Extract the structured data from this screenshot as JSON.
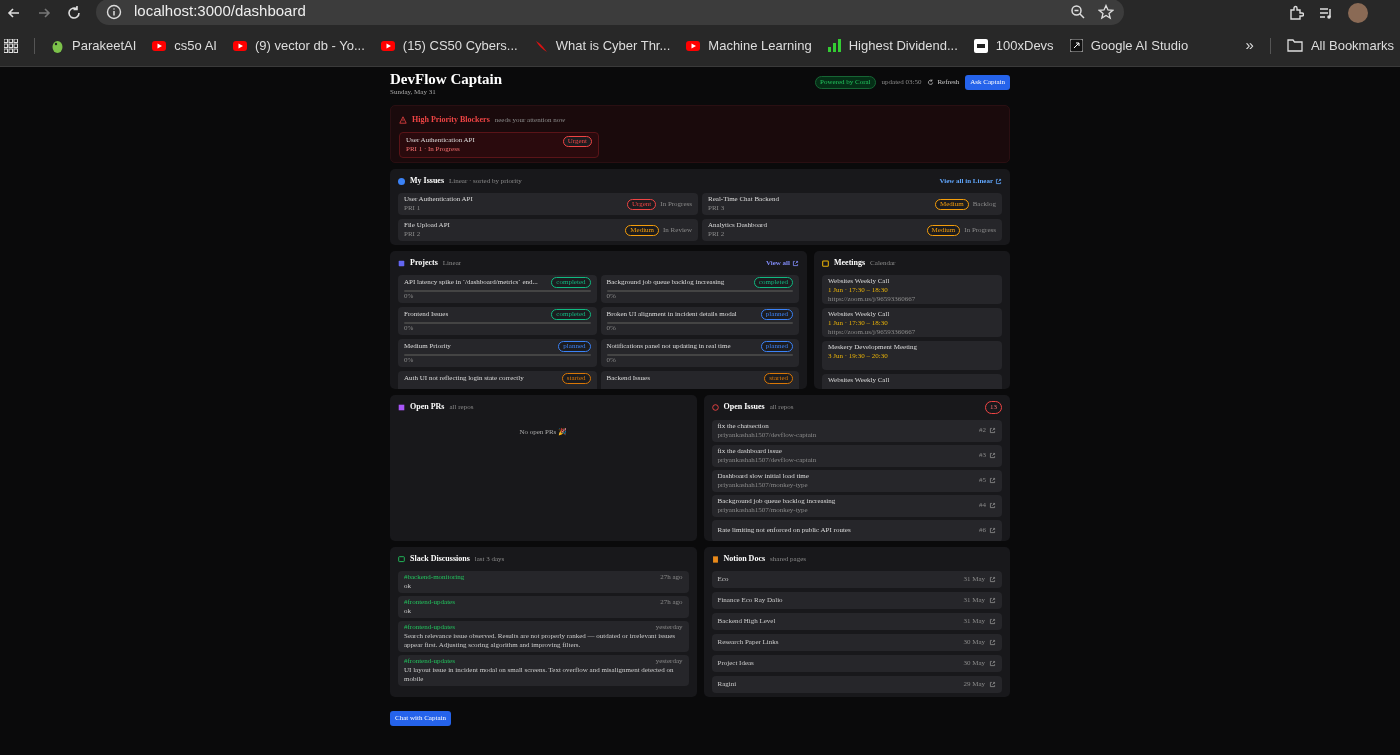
{
  "browser": {
    "url": "localhost:3000/dashboard",
    "bookmarks": [
      {
        "label": "ParakeetAI",
        "kind": "parakeet"
      },
      {
        "label": "cs5o AI",
        "kind": "video"
      },
      {
        "label": "(9) vector db - Yo...",
        "kind": "video"
      },
      {
        "label": "(15) CS50 Cybers...",
        "kind": "video"
      },
      {
        "label": "What is Cyber Thr...",
        "kind": "slash"
      },
      {
        "label": "Machine Learning",
        "kind": "video"
      },
      {
        "label": "Highest Dividend...",
        "kind": "bars"
      },
      {
        "label": "100xDevs",
        "kind": "tile"
      },
      {
        "label": "Google AI Studio",
        "kind": "studio"
      }
    ],
    "overflow": "»",
    "all_bookmarks": "All Bookmarks"
  },
  "header": {
    "title": "DevFlow Captain",
    "date": "Sunday, May 31",
    "powered": "Powered by Coral",
    "updated": "updated 03:50",
    "refresh": "Refresh",
    "ask": "Ask Captain"
  },
  "blockers": {
    "title": "High Priority Blockers",
    "subtitle": "needs your attention now",
    "items": [
      {
        "title": "User Authentication API",
        "meta": "PRI 1 · In Progress",
        "badge": {
          "label": "Urgent",
          "color": "#ef4444"
        }
      }
    ]
  },
  "my_issues": {
    "title": "My Issues",
    "subtitle": "Linear · sorted by priority",
    "link": "View all in Linear",
    "items": [
      {
        "title": "User Authentication API",
        "meta": "PRI 1",
        "badge": {
          "label": "Urgent",
          "color": "#ef4444"
        },
        "status": "In Progress"
      },
      {
        "title": "Real-Time Chat Backend",
        "meta": "PRI 3",
        "badge": {
          "label": "Medium",
          "color": "#f59e0b"
        },
        "status": "Backlog"
      },
      {
        "title": "File Upload API",
        "meta": "PRI 2",
        "badge": {
          "label": "Medium",
          "color": "#f59e0b"
        },
        "status": "In Review"
      },
      {
        "title": "Analytics Dashboard",
        "meta": "PRI 2",
        "badge": {
          "label": "Medium",
          "color": "#f59e0b"
        },
        "status": "In Progress"
      }
    ]
  },
  "projects": {
    "title": "Projects",
    "subtitle": "Linear",
    "link": "View all",
    "items": [
      {
        "title": "API latency spike in `/dashboard/metrics` end...",
        "badge": {
          "label": "completed",
          "color": "#10b981"
        },
        "level": 0,
        "percent": "0%"
      },
      {
        "title": "Background job queue backlog increasing",
        "badge": {
          "label": "completed",
          "color": "#10b981"
        },
        "level": 0,
        "percent": "0%"
      },
      {
        "title": "Frontend Issues",
        "badge": {
          "label": "completed",
          "color": "#10b981"
        },
        "level": 0,
        "percent": "0%"
      },
      {
        "title": "Broken UI alignment in incident details modal",
        "badge": {
          "label": "planned",
          "color": "#3b82f6"
        },
        "level": 0,
        "percent": "0%"
      },
      {
        "title": "Medium Priority",
        "badge": {
          "label": "planned",
          "color": "#3b82f6"
        },
        "level": 0,
        "percent": "0%"
      },
      {
        "title": "Notifications panel not updating in real time",
        "badge": {
          "label": "planned",
          "color": "#3b82f6"
        },
        "level": 0,
        "percent": "0%"
      },
      {
        "title": "Auth UI not reflecting login state correctly",
        "badge": {
          "label": "started",
          "color": "#d97706"
        }
      },
      {
        "title": "Backend Issues",
        "badge": {
          "label": "started",
          "color": "#d97706"
        }
      }
    ]
  },
  "meetings": {
    "title": "Meetings",
    "subtitle": "Calendar",
    "items": [
      {
        "title": "Websites Weekly Call",
        "time": "1 Jun · 17:30 – 18:30",
        "link": "https://zoom.us/j/96593360667"
      },
      {
        "title": "Websites Weekly Call",
        "time": "1 Jun · 17:30 – 18:30",
        "link": "https://zoom.us/j/96593360667"
      },
      {
        "title": "Meskery Development Meeting",
        "time": "3 Jun · 19:30 – 20:30"
      },
      {
        "title": "Websites Weekly Call"
      }
    ]
  },
  "open_prs": {
    "title": "Open PRs",
    "subtitle": "all repos",
    "empty": "No open PRs 🎉"
  },
  "open_issues": {
    "title": "Open Issues",
    "subtitle": "all repos",
    "count": "13",
    "items": [
      {
        "title": "fix the chatsection",
        "repo": "priyankashah1507/devflow-captain",
        "number": "#2"
      },
      {
        "title": "fix the dashboard issue",
        "repo": "priyankashah1507/devflow-captain",
        "number": "#3"
      },
      {
        "title": "Dashboard slow initial load time",
        "repo": "priyankashah1507/monkey-type",
        "number": "#5"
      },
      {
        "title": "Background job queue backlog increasing",
        "repo": "priyankashah1507/monkey-type",
        "number": "#4"
      },
      {
        "title": "Rate limiting not enforced on public API routes",
        "number": "#6"
      }
    ]
  },
  "slack": {
    "title": "Slack Discussions",
    "subtitle": "last 3 days",
    "items": [
      {
        "channel": "#backend-monitoring",
        "time": "27h ago",
        "text": "ok"
      },
      {
        "channel": "#frontend-updates",
        "time": "27h ago",
        "text": "ok"
      },
      {
        "channel": "#frontend-updates",
        "time": "yesterday",
        "text": "Search relevance issue observed. Results are not properly ranked — outdated or irrelevant issues appear first. Adjusting scoring algorithm and improving filters."
      },
      {
        "channel": "#frontend-updates",
        "time": "yesterday",
        "text": "UI layout issue in incident modal on small screens. Text overflow and misalignment detected on mobile"
      }
    ]
  },
  "notion": {
    "title": "Notion Docs",
    "subtitle": "shared pages",
    "items": [
      {
        "title": "Eco",
        "date": "31 May"
      },
      {
        "title": "Finance Eco Ray Dalio",
        "date": "31 May"
      },
      {
        "title": "Backend High Level",
        "date": "31 May"
      },
      {
        "title": "Research Paper Links",
        "date": "30 May"
      },
      {
        "title": "Project Ideas",
        "date": "30 May"
      },
      {
        "title": "Ragini",
        "date": "29 May"
      }
    ]
  },
  "chat_button": "Chat with Captain"
}
